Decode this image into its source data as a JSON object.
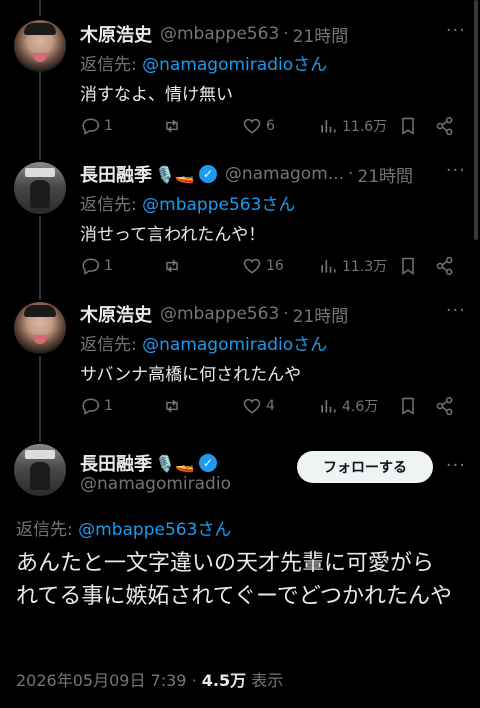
{
  "tweets": [
    {
      "name": "木原浩史",
      "handle": "@mbappe563",
      "time": "21時間",
      "reply_label": "返信先:",
      "reply_to": "@namagomiradioさん",
      "text": "消すなよ、情け無い",
      "stats": {
        "replies": "1",
        "retweets": "",
        "likes": "6",
        "views": "11.6万"
      }
    },
    {
      "name": "長田融季",
      "badges": "🎙️🚤",
      "handle": "@namagom...",
      "time": "21時間",
      "reply_label": "返信先:",
      "reply_to": "@mbappe563さん",
      "text": "消せって言われたんや！",
      "stats": {
        "replies": "1",
        "retweets": "",
        "likes": "16",
        "views": "11.3万"
      }
    },
    {
      "name": "木原浩史",
      "handle": "@mbappe563",
      "time": "21時間",
      "reply_label": "返信先:",
      "reply_to": "@namagomiradioさん",
      "text": "サバンナ高橋に何されたんや",
      "stats": {
        "replies": "1",
        "retweets": "",
        "likes": "4",
        "views": "4.6万"
      }
    }
  ],
  "main": {
    "name": "長田融季",
    "badges": "🎙️🚤",
    "handle": "@namagomiradio",
    "follow_label": "フォローする",
    "reply_label": "返信先:",
    "reply_to": "@mbappe563さん",
    "text": "あんたと一文字違いの天才先輩に可愛がられてる事に嫉妬されてぐーでどつかれたんや",
    "date": "2026年05月09日 7:39",
    "views": "4.5万",
    "views_label": "表示"
  },
  "colors": {
    "background": "#000000",
    "text": "#e7e9ea",
    "muted": "#71767b",
    "link": "#1d9bf0",
    "verified": "#1d9bf0"
  }
}
